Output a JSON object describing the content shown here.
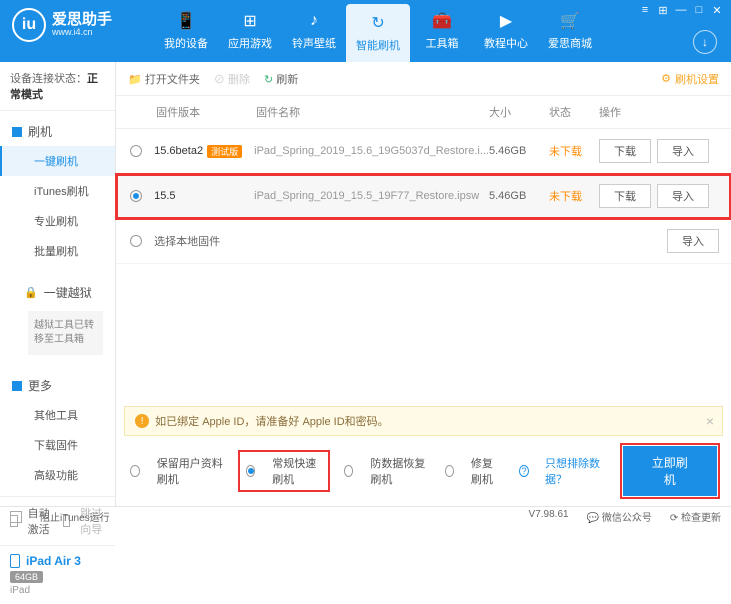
{
  "app": {
    "title": "爱思助手",
    "url": "www.i4.cn"
  },
  "titlebar_icons": [
    "menu-icon",
    "grid-icon",
    "minimize-icon",
    "maximize-icon",
    "close-icon"
  ],
  "nav": [
    {
      "label": "我的设备",
      "icon": "📱"
    },
    {
      "label": "应用游戏",
      "icon": "⊞"
    },
    {
      "label": "铃声壁纸",
      "icon": "♪"
    },
    {
      "label": "智能刷机",
      "icon": "↻",
      "active": true
    },
    {
      "label": "工具箱",
      "icon": "🧰"
    },
    {
      "label": "教程中心",
      "icon": "▶"
    },
    {
      "label": "爱思商城",
      "icon": "🛒"
    }
  ],
  "sidebar": {
    "conn_label": "设备连接状态：",
    "conn_value": "正常模式",
    "groups": [
      {
        "title": "刷机",
        "items": [
          "一键刷机",
          "iTunes刷机",
          "专业刷机",
          "批量刷机"
        ],
        "active_index": 0
      },
      {
        "title": "一键越狱",
        "lock": true,
        "note": "越狱工具已转移至工具箱"
      },
      {
        "title": "更多",
        "items": [
          "其他工具",
          "下载固件",
          "高级功能"
        ]
      }
    ],
    "auto_activate": "自动激活",
    "skip_guide": "跳过向导",
    "device": {
      "name": "iPad Air 3",
      "storage": "64GB",
      "type": "iPad"
    }
  },
  "toolbar": {
    "open_folder": "打开文件夹",
    "delete": "删除",
    "refresh": "刷新",
    "settings": "刷机设置"
  },
  "table": {
    "headers": {
      "version": "固件版本",
      "name": "固件名称",
      "size": "大小",
      "status": "状态",
      "ops": "操作"
    },
    "rows": [
      {
        "selected": false,
        "version": "15.6beta2",
        "beta": "测试版",
        "name": "iPad_Spring_2019_15.6_19G5037d_Restore.i...",
        "size": "5.46GB",
        "status": "未下载",
        "highlighted": false
      },
      {
        "selected": true,
        "version": "15.5",
        "name": "iPad_Spring_2019_15.5_19F77_Restore.ipsw",
        "size": "5.46GB",
        "status": "未下载",
        "highlighted": true
      }
    ],
    "local_fw": "选择本地固件",
    "btn_download": "下载",
    "btn_import": "导入"
  },
  "alert": "如已绑定 Apple ID，请准备好 Apple ID和密码。",
  "options": [
    {
      "label": "保留用户资料刷机",
      "selected": false
    },
    {
      "label": "常规快速刷机",
      "selected": true,
      "boxed": true
    },
    {
      "label": "防数据恢复刷机",
      "selected": false
    },
    {
      "label": "修复刷机",
      "selected": false
    }
  ],
  "exclude_link": "只想排除数据？",
  "primary_action": "立即刷机",
  "statusbar": {
    "block_itunes": "阻止iTunes运行",
    "version": "V7.98.61",
    "wechat": "微信公众号",
    "check_update": "检查更新"
  }
}
